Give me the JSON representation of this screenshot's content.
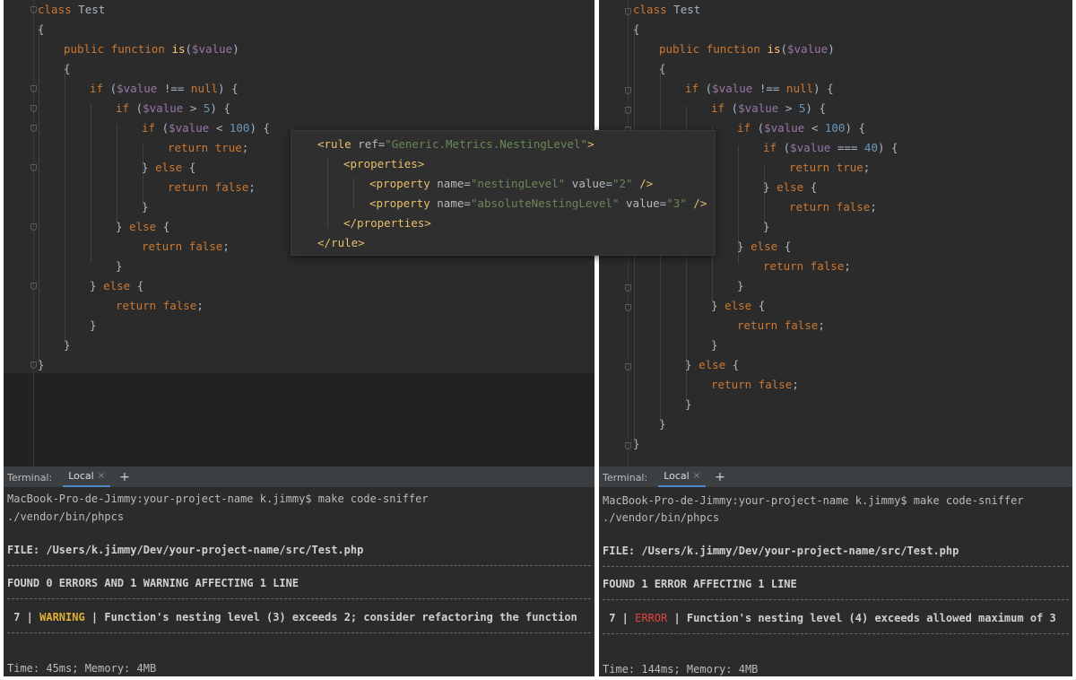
{
  "left": {
    "code": {
      "class_kw": "class",
      "class_name": "Test",
      "open_brace": "{",
      "close_brace": "}",
      "public_kw": "public",
      "function_kw": "function",
      "fn_name": "is",
      "param": "$value",
      "if_kw": "if",
      "else_kw": "else",
      "return_kw": "return",
      "true_kw": "true",
      "false_kw": "false",
      "null_kw": "null",
      "var": "$value",
      "op_neq": "!==",
      "op_gt": ">",
      "op_lt": "<",
      "num_5": "5",
      "num_100": "100"
    },
    "terminal": {
      "label": "Terminal:",
      "tab": "Local",
      "close": "×",
      "add": "+",
      "lines": {
        "prompt": "MacBook-Pro-de-Jimmy:your-project-name k.jimmy$ make code-sniffer",
        "cmd": "./vendor/bin/phpcs",
        "file": "FILE: /Users/k.jimmy/Dev/your-project-name/src/Test.php",
        "found": "FOUND 0 ERRORS AND 1 WARNING AFFECTING 1 LINE",
        "row_num": " 7 | ",
        "row_type": "WARNING",
        "row_msg": " | Function's nesting level (3) exceeds 2; consider refactoring the function",
        "time": "Time: 45ms; Memory: 4MB"
      }
    }
  },
  "right": {
    "code": {
      "num_40": "40",
      "op_eq": "==="
    },
    "terminal": {
      "label": "Terminal:",
      "tab": "Local",
      "close": "×",
      "add": "+",
      "lines": {
        "prompt": "MacBook-Pro-de-Jimmy:your-project-name k.jimmy$ make code-sniffer",
        "cmd": "./vendor/bin/phpcs",
        "file": "FILE: /Users/k.jimmy/Dev/your-project-name/src/Test.php",
        "found": "FOUND 1 ERROR AFFECTING 1 LINE",
        "row_num": " 7 | ",
        "row_type": "ERROR",
        "row_msg": " | Function's nesting level (4) exceeds allowed maximum of 3",
        "time": "Time: 144ms; Memory: 4MB"
      }
    }
  },
  "popup": {
    "rule_open": "<rule",
    "ref_attr": "ref",
    "ref_val": "\"Generic.Metrics.NestingLevel\"",
    "gt": ">",
    "props_open": "<properties>",
    "prop_tag": "<property",
    "name_attr": "name",
    "value_attr": "value",
    "prop1_name": "\"nestingLevel\"",
    "prop1_value": "\"2\"",
    "prop2_name": "\"absoluteNestingLevel\"",
    "prop2_value": "\"3\"",
    "self_close": "/>",
    "props_close": "</properties>",
    "rule_close": "</rule>",
    "eq": "="
  }
}
